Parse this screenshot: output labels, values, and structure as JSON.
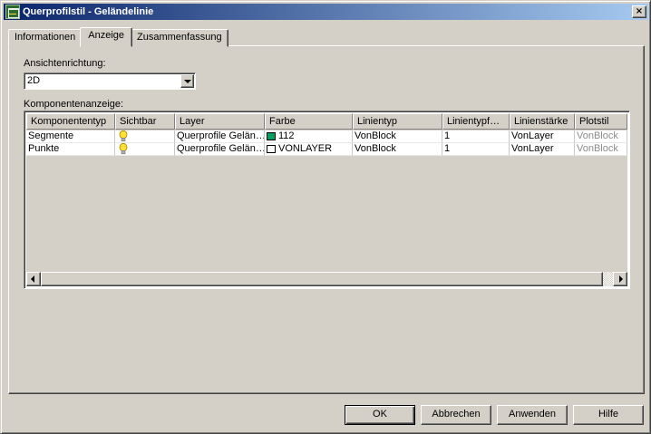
{
  "window": {
    "title": "Querprofilstil - Geländelinie",
    "close_label": "×"
  },
  "tabs": [
    {
      "label": "Informationen",
      "active": false
    },
    {
      "label": "Anzeige",
      "active": true
    },
    {
      "label": "Zusammenfassung",
      "active": false
    }
  ],
  "view_direction": {
    "label": "Ansichtenrichtung:",
    "value": "2D"
  },
  "component_display": {
    "label": "Komponentenanzeige:",
    "columns": [
      "Komponententyp",
      "Sichtbar",
      "Layer",
      "Farbe",
      "Linientyp",
      "Linientypf…",
      "Linienstärke",
      "Plotstil"
    ],
    "rows": [
      {
        "type": "Segmente",
        "visible_icon": "lightbulb-on-icon",
        "layer": "Querprofile Gelän…",
        "color": "112",
        "color_swatch": "#00a060",
        "linetype": "VonBlock",
        "linetype_scale": "1",
        "lineweight": "VonLayer",
        "plotstyle": "VonBlock"
      },
      {
        "type": "Punkte",
        "visible_icon": "lightbulb-on-icon",
        "layer": "Querprofile Gelän…",
        "color": "VONLAYER",
        "color_swatch": "#ffffff",
        "linetype": "VonBlock",
        "linetype_scale": "1",
        "lineweight": "VonLayer",
        "plotstyle": "VonBlock"
      }
    ]
  },
  "buttons": {
    "ok": "OK",
    "cancel": "Abbrechen",
    "apply": "Anwenden",
    "help": "Hilfe"
  }
}
